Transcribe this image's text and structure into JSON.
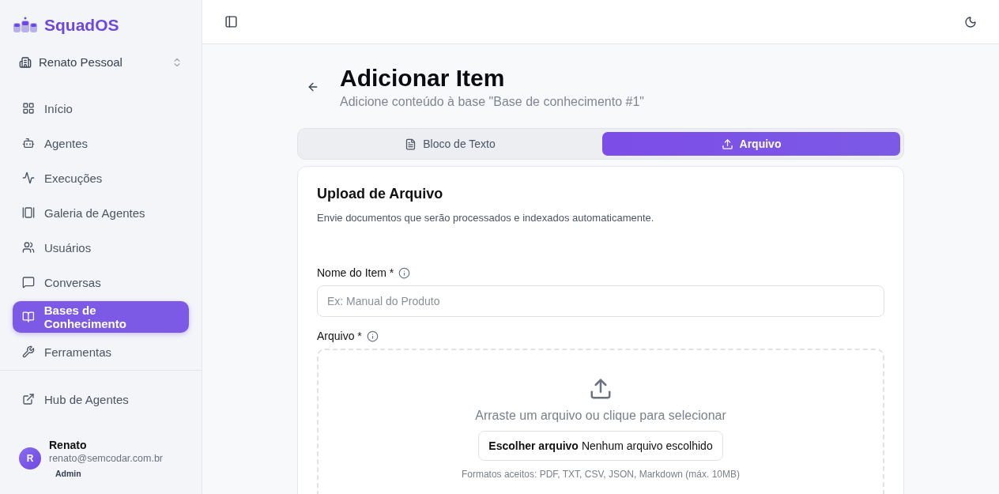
{
  "brand": {
    "name": "SquadOS"
  },
  "workspace": {
    "name": "Renato Pessoal"
  },
  "sidebar": {
    "items": [
      {
        "label": "Início",
        "selected": false
      },
      {
        "label": "Agentes",
        "selected": false
      },
      {
        "label": "Execuções",
        "selected": false
      },
      {
        "label": "Galeria de Agentes",
        "selected": false
      },
      {
        "label": "Usuários",
        "selected": false
      },
      {
        "label": "Conversas",
        "selected": false
      },
      {
        "label": "Bases de Conhecimento",
        "selected": true
      },
      {
        "label": "Ferramentas",
        "selected": false
      }
    ],
    "footer_link": {
      "label": "Hub de Agentes"
    },
    "user": {
      "initial": "R",
      "name": "Renato",
      "email": "renato@semcodar.com.br",
      "role": "Admin"
    }
  },
  "page": {
    "title": "Adicionar Item",
    "subtitle": "Adicione conteúdo à base \"Base de conhecimento #1\""
  },
  "tabs": [
    {
      "label": "Bloco de Texto",
      "selected": false
    },
    {
      "label": "Arquivo",
      "selected": true
    }
  ],
  "card": {
    "title": "Upload de Arquivo",
    "description": "Envie documentos que serão processados e indexados automaticamente.",
    "name_field": {
      "label": "Nome do Item *",
      "placeholder": "Ex: Manual do Produto"
    },
    "file_field": {
      "label": "Arquivo *",
      "prompt": "Arraste um arquivo ou clique para selecionar",
      "button": "Escolher arquivo",
      "status": "Nenhum arquivo escolhido",
      "hint": "Formatos aceitos: PDF, TXT, CSV, JSON, Markdown (máx. 10MB)"
    }
  }
}
